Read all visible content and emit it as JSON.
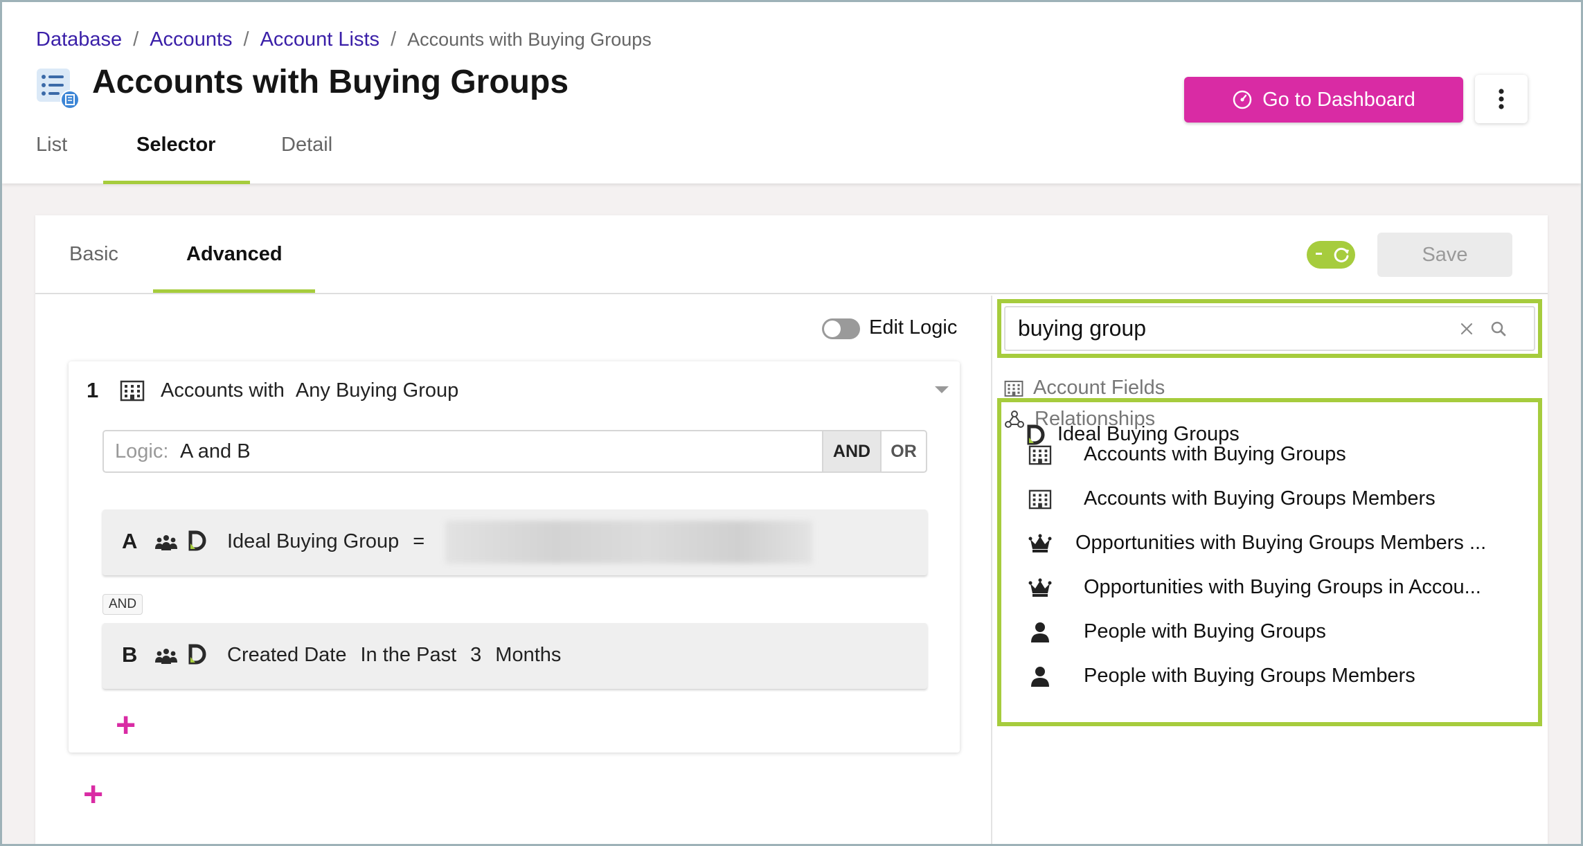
{
  "breadcrumb": {
    "items": [
      "Database",
      "Accounts",
      "Account Lists"
    ],
    "current": "Accounts with Buying Groups",
    "separator": "/"
  },
  "page": {
    "title": "Accounts with Buying Groups"
  },
  "header": {
    "dashboard_label": "Go to Dashboard",
    "tabs": [
      {
        "label": "List",
        "active": false
      },
      {
        "label": "Selector",
        "active": true
      },
      {
        "label": "Detail",
        "active": false
      }
    ]
  },
  "card": {
    "tabs": [
      {
        "label": "Basic",
        "active": false
      },
      {
        "label": "Advanced",
        "active": true
      }
    ],
    "save_label": "Save"
  },
  "builder": {
    "edit_logic_label": "Edit Logic",
    "group": {
      "number": "1",
      "label_prefix": "Accounts with",
      "label_value": "Any Buying Group",
      "logic_prefix": "Logic:",
      "logic_value": "A and B",
      "and_label": "AND",
      "or_label": "OR",
      "and_chip": "AND",
      "conditions": [
        {
          "letter": "A",
          "field": "Ideal Buying Group",
          "operator": "=",
          "value": ""
        },
        {
          "letter": "B",
          "field": "Created Date",
          "operator": "In the Past",
          "amount": "3",
          "unit": "Months"
        }
      ]
    },
    "add_condition": "+",
    "add_group": "+"
  },
  "search": {
    "value": "buying group",
    "account_fields_heading": "Account Fields",
    "account_fields": [
      {
        "label": "Ideal Buying Groups",
        "icon": "d-logo-icon"
      }
    ],
    "relationships_heading": "Relationships",
    "relationships": [
      {
        "label": "Accounts with Buying Groups",
        "icon": "building-icon"
      },
      {
        "label": "Accounts with Buying Groups Members",
        "icon": "building-icon"
      },
      {
        "label": "Opportunities with Buying Groups Members ...",
        "icon": "crown-icon"
      },
      {
        "label": "Opportunities with Buying Groups in Accou...",
        "icon": "crown-icon"
      },
      {
        "label": "People with Buying Groups",
        "icon": "person-icon"
      },
      {
        "label": "People with Buying Groups Members",
        "icon": "person-icon"
      }
    ]
  },
  "colors": {
    "accent_green": "#a6cc3d",
    "brand_magenta": "#d92ba4",
    "link_purple": "#3a1fa8"
  }
}
